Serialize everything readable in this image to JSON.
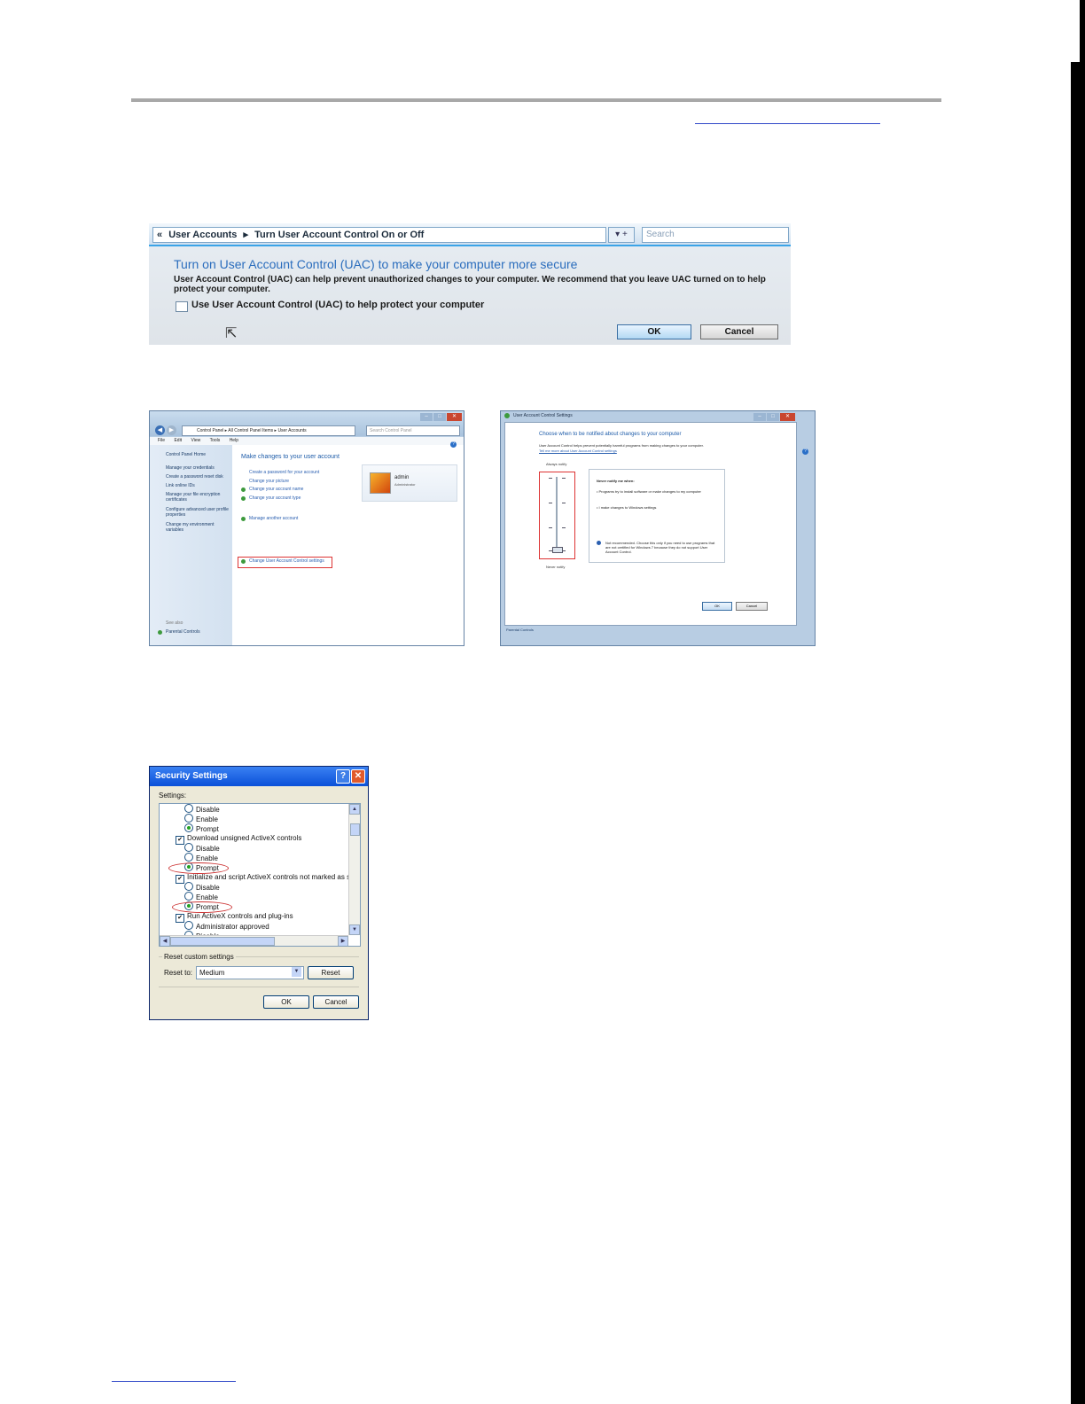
{
  "uac_vista": {
    "breadcrumb_back": "«",
    "breadcrumb_1": "User Accounts",
    "breadcrumb_sep": "▸",
    "breadcrumb_2": "Turn User Account Control On or Off",
    "search_placeholder": "Search",
    "go_label": "▾ +",
    "heading": "Turn on User Account Control (UAC) to make your computer more secure",
    "description": "User Account Control (UAC) can help prevent unauthorized changes to your computer. We recommend that you leave UAC turned on to help protect your computer.",
    "checkbox_label": "Use User Account Control (UAC) to help protect your computer",
    "ok_label": "OK",
    "cancel_label": "Cancel"
  },
  "control_panel": {
    "address": "Control Panel ▸ All Control Panel Items ▸ User Accounts",
    "search_placeholder": "Search Control Panel",
    "menu": [
      "File",
      "Edit",
      "View",
      "Tools",
      "Help"
    ],
    "sidebar_home": "Control Panel Home",
    "sidebar_items": [
      "Manage your credentials",
      "Create a password reset disk",
      "Link online IDs",
      "Manage your file encryption certificates",
      "Configure advanced user profile properties",
      "Change my environment variables"
    ],
    "see_also": "See also",
    "parental_controls": "Parental Controls",
    "heading": "Make changes to your user account",
    "links": [
      "Create a password for your account",
      "Change your picture",
      "Change your account name",
      "Change your account type"
    ],
    "manage_other": "Manage another account",
    "change_uac": "Change User Account Control settings",
    "user_name": "admin",
    "user_role": "Administrator"
  },
  "uac_settings": {
    "window_title": "User Account Control Settings",
    "heading": "Choose when to be notified about changes to your computer",
    "description": "User Account Control helps prevent potentially harmful programs from making changes to your computer.",
    "tell_more": "Tell me more about User Account Control settings",
    "always_notify": "Always notify",
    "never_notify": "Never notify",
    "panel_heading": "Never notify me when:",
    "bullets": [
      "Programs try to install software or make changes to my computer",
      "I make changes to Windows settings"
    ],
    "info": "Not recommended. Choose this only if you need to use programs that are not certified for Windows 7 because they do not support User Account Control.",
    "ok_label": "OK",
    "cancel_label": "Cancel",
    "footer": "Parental Controls",
    "slider_level": 0
  },
  "security_settings": {
    "title": "Security Settings",
    "settings_label": "Settings:",
    "rows": [
      {
        "kind": "radio",
        "label": "Disable",
        "on": false
      },
      {
        "kind": "radio",
        "label": "Enable",
        "on": false
      },
      {
        "kind": "radio",
        "label": "Prompt",
        "on": true
      },
      {
        "kind": "check",
        "label": "Download unsigned ActiveX controls"
      },
      {
        "kind": "radio",
        "label": "Disable",
        "on": false
      },
      {
        "kind": "radio",
        "label": "Enable",
        "on": false
      },
      {
        "kind": "radio",
        "label": "Prompt",
        "on": true
      },
      {
        "kind": "check",
        "label": "Initialize and script ActiveX controls not marked as safe"
      },
      {
        "kind": "radio",
        "label": "Disable",
        "on": false
      },
      {
        "kind": "radio",
        "label": "Enable",
        "on": false
      },
      {
        "kind": "radio",
        "label": "Prompt",
        "on": true
      },
      {
        "kind": "check",
        "label": "Run ActiveX controls and plug-ins"
      },
      {
        "kind": "radio",
        "label": "Administrator approved",
        "on": false
      },
      {
        "kind": "radio",
        "label": "Disable",
        "on": false
      }
    ],
    "group_label": "Reset custom settings",
    "reset_to_label": "Reset to:",
    "reset_value": "Medium",
    "reset_button": "Reset",
    "ok_label": "OK",
    "cancel_label": "Cancel",
    "help_glyph": "?",
    "close_glyph": "✕"
  }
}
